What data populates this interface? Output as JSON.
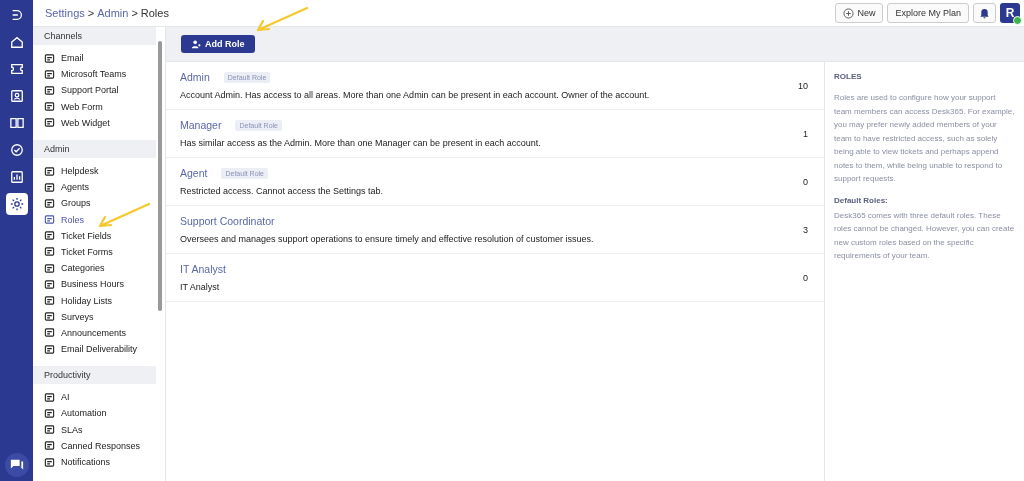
{
  "rail": {
    "items": [
      {
        "selected": false
      },
      {
        "selected": false
      },
      {
        "selected": false
      },
      {
        "selected": false
      },
      {
        "selected": false
      },
      {
        "selected": false
      },
      {
        "selected": false
      },
      {
        "selected": true
      }
    ]
  },
  "breadcrumb": [
    {
      "text": "Settings",
      "kind": "link"
    },
    {
      "text": ">",
      "kind": "sep"
    },
    {
      "text": "Admin",
      "kind": "link"
    },
    {
      "text": ">",
      "kind": "sep"
    },
    {
      "text": "Roles",
      "kind": "current"
    }
  ],
  "header": {
    "new_button": "New",
    "plan_button": "Explore My Plan",
    "avatar": "R"
  },
  "sidebar": {
    "sections": [
      {
        "title": "Channels",
        "items": [
          {
            "label": "Email",
            "selected": false
          },
          {
            "label": "Microsoft Teams",
            "selected": false
          },
          {
            "label": "Support Portal",
            "selected": false
          },
          {
            "label": "Web Form",
            "selected": false
          },
          {
            "label": "Web Widget",
            "selected": false
          }
        ]
      },
      {
        "title": "Admin",
        "items": [
          {
            "label": "Helpdesk",
            "selected": false
          },
          {
            "label": "Agents",
            "selected": false
          },
          {
            "label": "Groups",
            "selected": false
          },
          {
            "label": "Roles",
            "selected": true
          },
          {
            "label": "Ticket Fields",
            "selected": false
          },
          {
            "label": "Ticket Forms",
            "selected": false
          },
          {
            "label": "Categories",
            "selected": false
          },
          {
            "label": "Business Hours",
            "selected": false
          },
          {
            "label": "Holiday Lists",
            "selected": false
          },
          {
            "label": "Surveys",
            "selected": false
          },
          {
            "label": "Announcements",
            "selected": false
          },
          {
            "label": "Email Deliverability",
            "selected": false
          }
        ]
      },
      {
        "title": "Productivity",
        "items": [
          {
            "label": "AI",
            "selected": false
          },
          {
            "label": "Automation",
            "selected": false
          },
          {
            "label": "SLAs",
            "selected": false
          },
          {
            "label": "Canned Responses",
            "selected": false
          },
          {
            "label": "Notifications",
            "selected": false
          }
        ]
      }
    ]
  },
  "toolbar": {
    "add_button": "Add Role"
  },
  "roles": [
    {
      "name": "Admin",
      "badge": "Default Role",
      "description": "Account Admin. Has access to all areas. More than one Admin can be present in each account. Owner of the account.",
      "count": "10"
    },
    {
      "name": "Manager",
      "badge": "Default Role",
      "description": "Has similar access as the Admin. More than one Manager can be present in each account.",
      "count": "1"
    },
    {
      "name": "Agent",
      "badge": "Default Role",
      "description": "Restricted access. Cannot access the Settings tab.",
      "count": "0"
    },
    {
      "name": "Support Coordinator",
      "description": "Oversees and manages support operations to ensure timely and effective resolution of customer issues.",
      "count": "3"
    },
    {
      "name": "IT Analyst",
      "description": "IT Analyst",
      "count": "0"
    }
  ],
  "info": {
    "title": "ROLES",
    "text": "Roles are used to configure how your support team members can access Desk365. For example, you may prefer newly added members of your team to have restricted access, such as solely being able to view tickets and perhaps append notes to them, while being unable to respond to support requests.",
    "subtitle": "Default Roles:",
    "subtext": "Desk365 comes with three default roles. These roles cannot be changed. However, you can create new custom roles based on the specific requirements of your team."
  }
}
